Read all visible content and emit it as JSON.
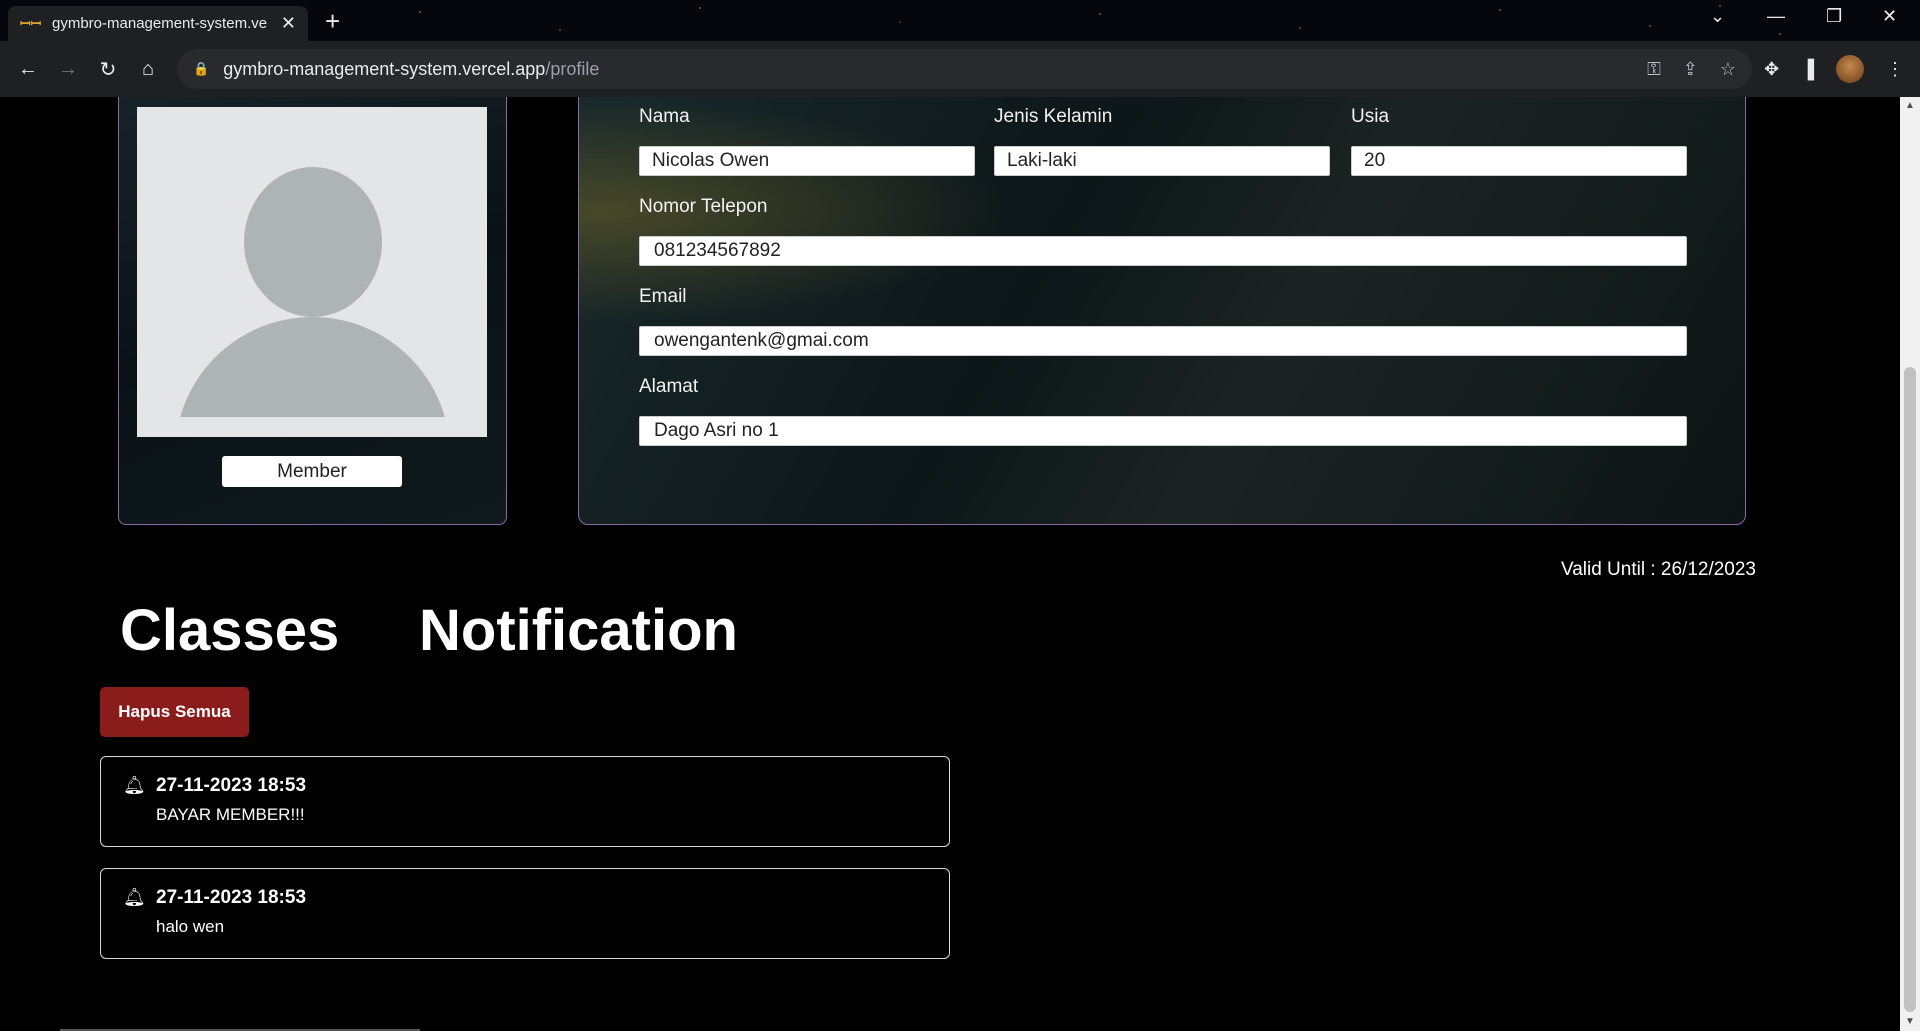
{
  "browser": {
    "tab_title": "gymbro-management-system.vercel.app",
    "tab_favicon": "ꟷꟷ",
    "url_host": "gymbro-management-system.vercel.app",
    "url_path": "/profile"
  },
  "profile": {
    "role": "Member",
    "fields": {
      "nama": {
        "label": "Nama",
        "value": "Nicolas Owen"
      },
      "jenis_kelamin": {
        "label": "Jenis Kelamin",
        "value": "Laki-laki"
      },
      "usia": {
        "label": "Usia",
        "value": "20"
      },
      "telepon": {
        "label": "Nomor Telepon",
        "value": "081234567892"
      },
      "email": {
        "label": "Email",
        "value": "owengantenk@gmai.com"
      },
      "alamat": {
        "label": "Alamat",
        "value": "Dago Asri no 1"
      }
    },
    "valid_until": "Valid Until : 26/12/2023"
  },
  "sections": {
    "classes": "Classes",
    "notification": "Notification"
  },
  "notifications": {
    "clear_all_label": "Hapus Semua",
    "items": [
      {
        "time": "27-11-2023 18:53",
        "message": "BAYAR MEMBER!!!"
      },
      {
        "time": "27-11-2023 18:53",
        "message": "halo wen"
      }
    ]
  }
}
